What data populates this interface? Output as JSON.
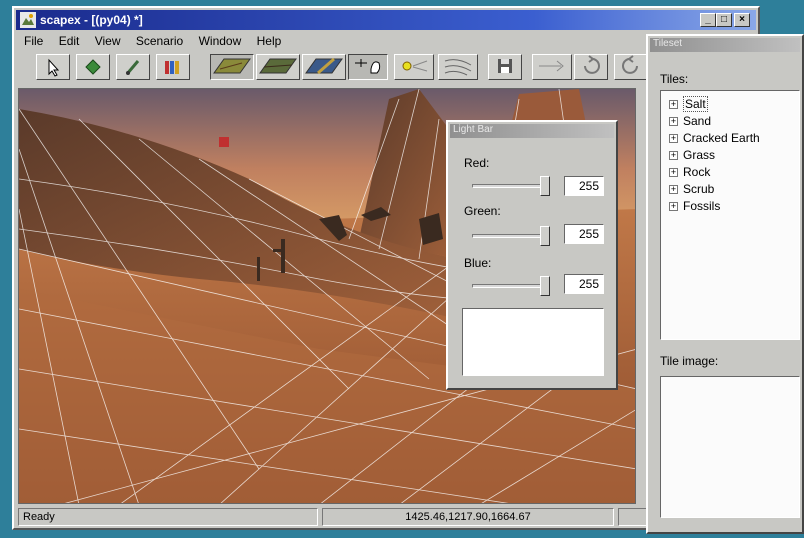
{
  "window": {
    "title": "scapex - [(py04) *]",
    "controls": {
      "minimize": "_",
      "maximize": "□",
      "close": "×"
    }
  },
  "menu": [
    "File",
    "Edit",
    "View",
    "Scenario",
    "Window",
    "Help"
  ],
  "toolbar": {
    "tools": [
      {
        "name": "select-arrow-icon"
      },
      {
        "name": "diamond-icon"
      },
      {
        "name": "brush-icon"
      },
      {
        "name": "palette-icon"
      },
      {
        "name": "terrain-view-1-icon"
      },
      {
        "name": "terrain-view-2-icon"
      },
      {
        "name": "terrain-view-3-icon"
      },
      {
        "name": "hand-tool-icon"
      },
      {
        "name": "light-icon"
      },
      {
        "name": "wind-icon"
      },
      {
        "name": "save-icon"
      },
      {
        "name": "connect-icon"
      },
      {
        "name": "rotate-icon"
      },
      {
        "name": "rotate-back-icon"
      }
    ]
  },
  "status": {
    "ready": "Ready",
    "coords": "1425.46,1217.90,1664.67"
  },
  "light_bar": {
    "title": "Light Bar",
    "red_label": "Red:",
    "red_value": "255",
    "green_label": "Green:",
    "green_value": "255",
    "blue_label": "Blue:",
    "blue_value": "255"
  },
  "tileset": {
    "title": "Tileset",
    "tiles_label": "Tiles:",
    "items": [
      "Salt",
      "Sand",
      "Cracked Earth",
      "Grass",
      "Rock",
      "Scrub",
      "Fossils"
    ],
    "tile_image_label": "Tile image:"
  },
  "colors": {
    "title_bar": "#1a2a8c",
    "sky": "#d9a060",
    "ground": "#b0603a"
  }
}
